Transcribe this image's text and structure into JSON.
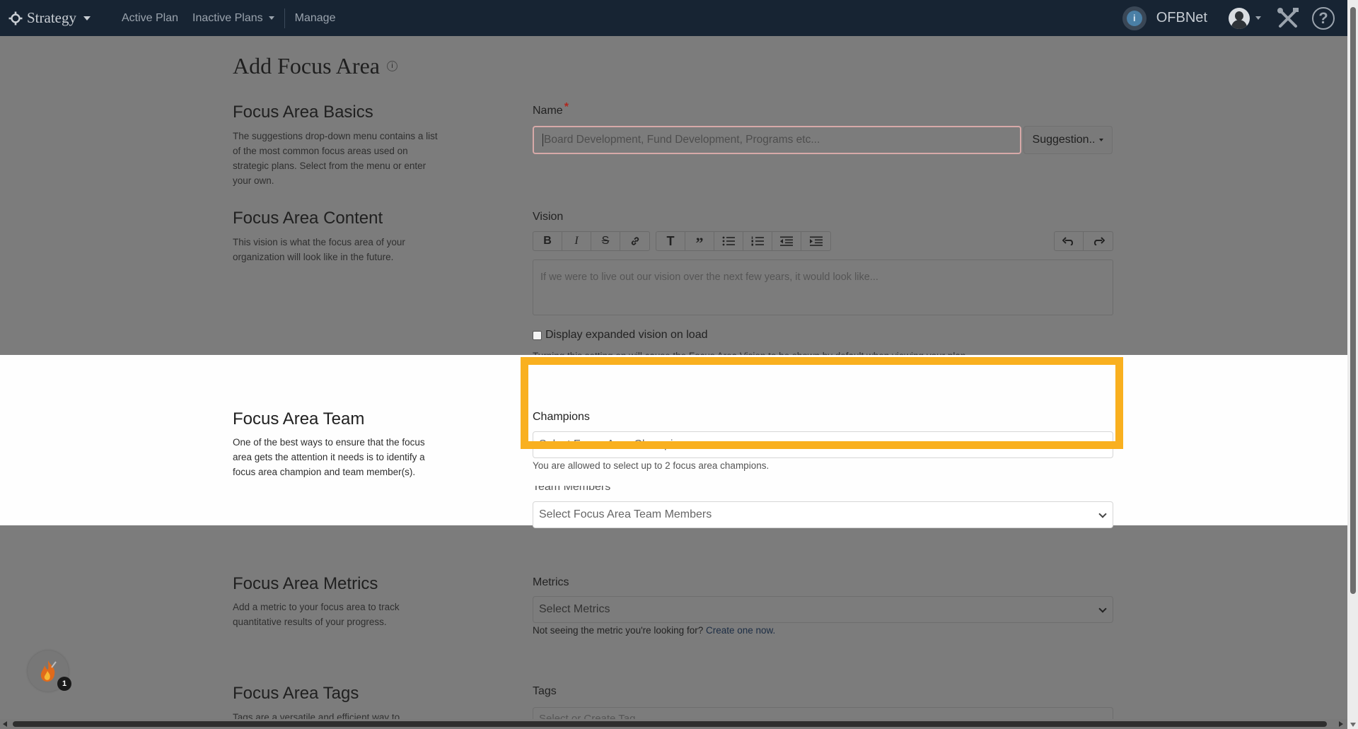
{
  "navbar": {
    "brand": "Strategy",
    "links": [
      "Active Plan",
      "Inactive Plans",
      "Manage"
    ],
    "org_badge": "i",
    "org_name": "OFBNet",
    "help": "?"
  },
  "page": {
    "title": "Add Focus Area",
    "info": "i"
  },
  "basics": {
    "heading": "Focus Area Basics",
    "description": "The suggestions drop-down menu contains a list of the most common focus areas used on strategic plans. Select from the menu or enter your own.",
    "name_label": "Name",
    "required_mark": "*",
    "name_placeholder": "Board Development, Fund Development, Programs etc...",
    "suggestions_label": "Suggestion.."
  },
  "content": {
    "heading": "Focus Area Content",
    "description": "This vision is what the focus area of your organization will look like in the future.",
    "vision_label": "Vision",
    "toolbar": {
      "bold": "B",
      "italic": "I",
      "strike": "S",
      "heading": "T",
      "quote": "”"
    },
    "vision_placeholder": "If we were to live out our vision over the next few years, it would look like...",
    "checkbox_label": "Display expanded vision on load",
    "checkbox_hint": "Turning this setting on will cause the Focus Area Vision to be shown by default when viewing your plan."
  },
  "team": {
    "heading": "Focus Area Team",
    "description": "One of the best ways to ensure that the focus area gets the attention it needs is to identify a focus area champion and team member(s).",
    "champions_label": "Champions",
    "champions_placeholder": "Select Focus Area Champions",
    "champions_hint": "You are allowed to select up to 2 focus area champions.",
    "members_label": "Team Members",
    "members_placeholder": "Select Focus Area Team Members"
  },
  "metrics": {
    "heading": "Focus Area Metrics",
    "description": "Add a metric to your focus area to track quantitative results of your progress.",
    "label": "Metrics",
    "placeholder": "Select Metrics",
    "hint_prefix": "Not seeing the metric you're looking for? ",
    "hint_link": "Create one now."
  },
  "tags": {
    "heading": "Focus Area Tags",
    "description": "Tags are a versatile and efficient way to",
    "label": "Tags",
    "placeholder": "Select or Create Tag"
  },
  "fab_badge": "1",
  "colors": {
    "navbar": "#172433",
    "highlight": "#f9b01f",
    "required": "#b0271e"
  }
}
